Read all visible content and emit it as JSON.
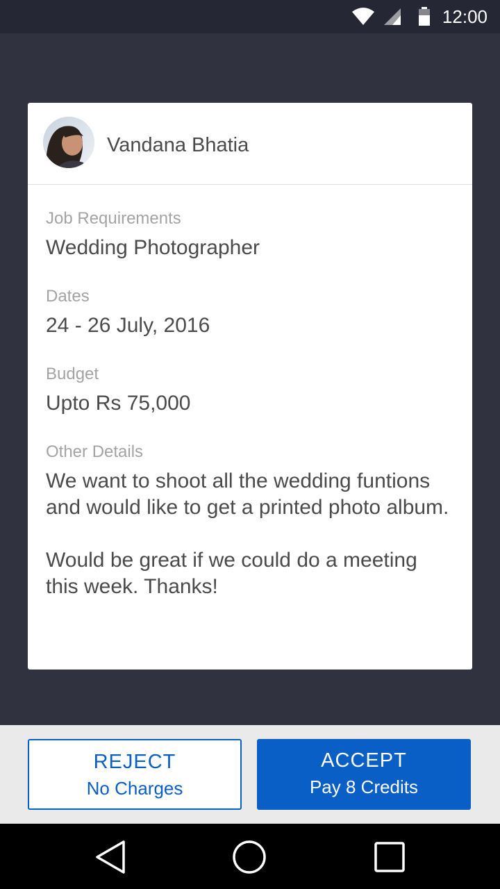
{
  "status_bar": {
    "time": "12:00",
    "icons": [
      "wifi-icon",
      "signal-icon",
      "battery-icon"
    ]
  },
  "user": {
    "name": "Vandana Bhatia",
    "avatar": "avatar-photo"
  },
  "request": {
    "job_label": "Job Requirements",
    "job_value": "Wedding Photographer",
    "dates_label": "Dates",
    "dates_value": "24 - 26 July, 2016",
    "budget_label": "Budget",
    "budget_value": "Upto Rs 75,000",
    "details_label": "Other Details",
    "details_value": "We want to shoot all the wedding funtions and would like to get a printed photo album.\n\nWould be great if we could do a meeting this week. Thanks!"
  },
  "actions": {
    "reject_label": "REJECT",
    "reject_sub": "No Charges",
    "accept_label": "ACCEPT",
    "accept_sub": "Pay 8 Credits"
  },
  "nav_bar": {
    "icons": [
      "back-icon",
      "home-icon",
      "recents-icon"
    ]
  },
  "colors": {
    "accent": "#0a5fc6",
    "background": "#31323f",
    "status_bar": "#262734",
    "card": "#ffffff",
    "label_text": "#a3a3a3",
    "value_text": "#4a4a4a"
  }
}
